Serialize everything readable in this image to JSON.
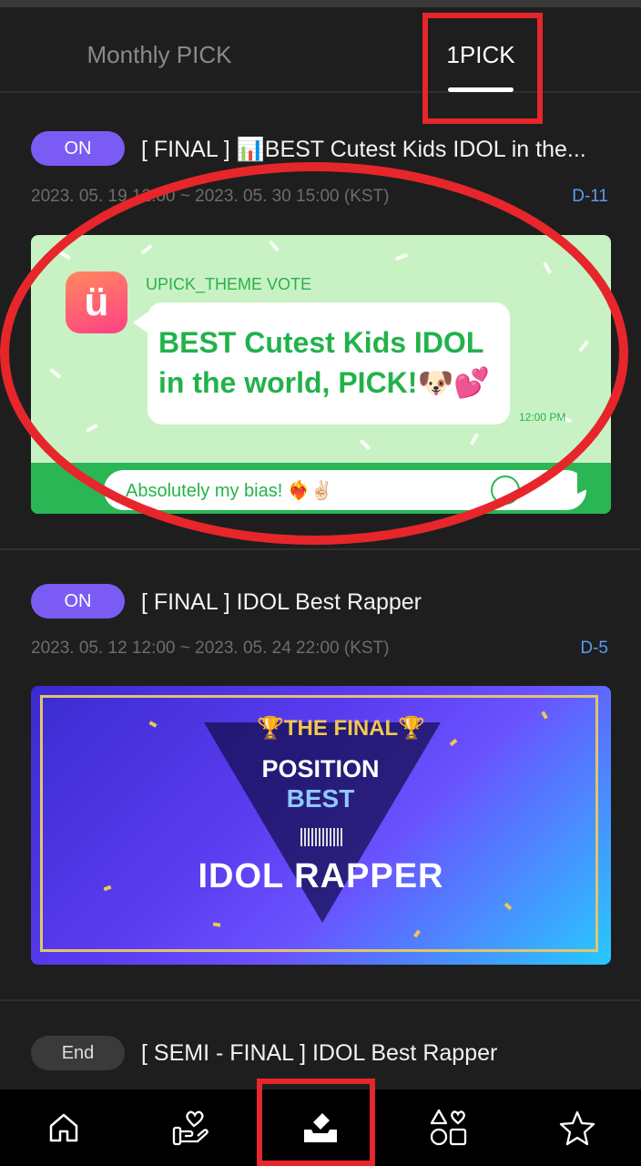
{
  "tabs": [
    {
      "label": "Monthly PICK",
      "active": false
    },
    {
      "label": "1PICK",
      "active": true
    }
  ],
  "votes": [
    {
      "status": "ON",
      "title": "[ FINAL ] 📊BEST Cutest Kids IDOL in the...",
      "date_range": "2023. 05. 19 12:00 ~ 2023. 05. 30 15:00 (KST)",
      "dday": "D-11",
      "banner": {
        "label": "UPICK_THEME VOTE",
        "headline_line1": "BEST Cutest Kids IDOL",
        "headline_line2": "in the world, PICK!🐶💕",
        "time": "12:00 PM",
        "chat_text": "Absolutely my bias! ❤️‍🔥✌🏻",
        "logo_letter": "ü"
      }
    },
    {
      "status": "ON",
      "title": "[ FINAL ] IDOL Best Rapper",
      "date_range": "2023. 05. 12 12:00 ~ 2023. 05. 24 22:00 (KST)",
      "dday": "D-5",
      "banner": {
        "final_label": "🏆THE FINAL🏆",
        "line1": "POSITION",
        "line2": "BEST",
        "line3": "IDOL RAPPER"
      }
    },
    {
      "status": "End",
      "title": "[ SEMI - FINAL ] IDOL Best Rapper"
    }
  ],
  "bottom_nav": [
    {
      "icon": "home-icon"
    },
    {
      "icon": "heart-hand-icon"
    },
    {
      "icon": "vote-box-icon",
      "active": true
    },
    {
      "icon": "shapes-icon"
    },
    {
      "icon": "star-icon"
    }
  ],
  "colors": {
    "background": "#1e1e1e",
    "badge_on": "#7a5cf5",
    "dday": "#5b9cf0",
    "highlight": "#e6262b"
  }
}
